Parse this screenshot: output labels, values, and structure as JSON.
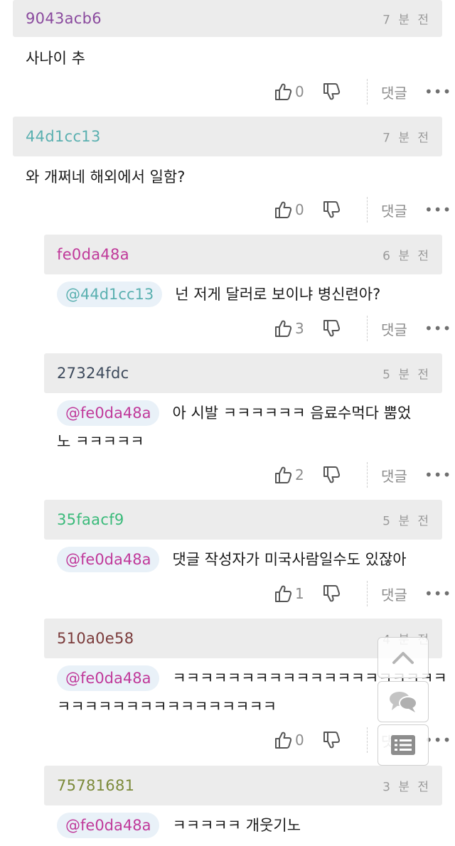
{
  "colors": {
    "header_bg": "#ececec",
    "mention_bg": "#e9f1f8",
    "text": "#1a1a1a",
    "muted": "#8c8c8c"
  },
  "actions": {
    "reply_label": "댓글",
    "more_label": "•••"
  },
  "comments": [
    {
      "user": "9043acb6",
      "user_color": "#8a4a9e",
      "time": "7 분 전",
      "mention": "",
      "mention_color": "",
      "text": "사나이 추",
      "likes": "0"
    },
    {
      "user": "44d1cc13",
      "user_color": "#5ab0b0",
      "time": "7 분 전",
      "mention": "",
      "mention_color": "",
      "text": "와 개쩌네 해외에서 일함?",
      "likes": "0"
    },
    {
      "user": "fe0da48a",
      "user_color": "#c0399a",
      "time": "6 분 전",
      "mention": "@44d1cc13",
      "mention_color": "#5ab0b0",
      "text": "넌 저게 달러로 보이냐 병신련아?",
      "likes": "3"
    },
    {
      "user": "27324fdc",
      "user_color": "#3d4a5c",
      "time": "5 분 전",
      "mention": "@fe0da48a",
      "mention_color": "#c0399a",
      "text": "아 시발 ㅋㅋㅋㅋㅋㅋ 음료수먹다 뿜었",
      "text2": "노 ㅋㅋㅋㅋㅋ",
      "likes": "2"
    },
    {
      "user": "35faacf9",
      "user_color": "#3aba7a",
      "time": "5 분 전",
      "mention": "@fe0da48a",
      "mention_color": "#c0399a",
      "text": "댓글 작성자가 미국사람일수도 있잖아",
      "likes": "1"
    },
    {
      "user": "510a0e58",
      "user_color": "#7a3a3a",
      "time": "4 분 전",
      "mention": "@fe0da48a",
      "mention_color": "#c0399a",
      "text": "ㅋㅋㅋㅋㅋㅋㅋㅋㅋㅋㅋㅋㅋㅋㅋㅋㅋㅋㅋㅋ",
      "text2": "ㅋㅋㅋㅋㅋㅋㅋㅋㅋㅋㅋㅋㅋㅋㅋㅋ",
      "likes": "0"
    },
    {
      "user": "75781681",
      "user_color": "#7c8a3a",
      "time": "3 분 전",
      "mention": "@fe0da48a",
      "mention_color": "#c0399a",
      "text": "ㅋㅋㅋㅋㅋ 개웃기노",
      "likes": ""
    }
  ],
  "floating": {
    "icons": [
      "chevron-up-icon",
      "comments-icon",
      "list-icon"
    ]
  }
}
